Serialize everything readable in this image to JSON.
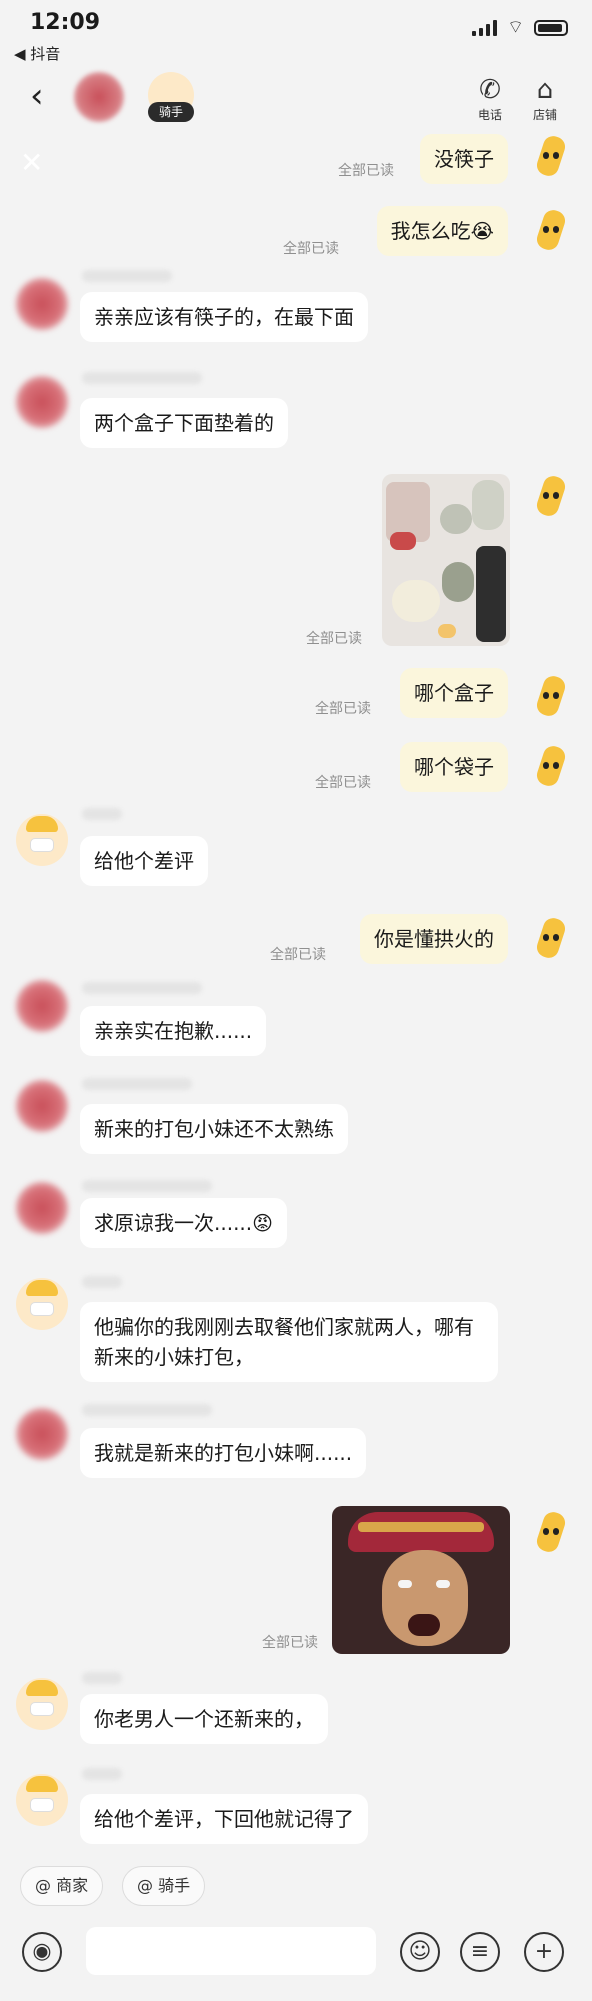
{
  "status": {
    "time": "12:09",
    "back_app": "◀ 抖音"
  },
  "header": {
    "rider_tag": "骑手",
    "phone_label": "电话",
    "store_label": "店铺"
  },
  "chat": {
    "read_label": "全部已读",
    "m1": "没筷子",
    "m2": "我怎么吃😭",
    "m3": "亲亲应该有筷子的，在最下面",
    "m4": "两个盒子下面垫着的",
    "m6": "哪个盒子",
    "m7": "哪个袋子",
    "m8": "给他个差评",
    "m9": "你是懂拱火的",
    "m10": "亲亲实在抱歉......",
    "m11": "新来的打包小妹还不太熟练",
    "m12": "求原谅我一次......😡",
    "m13": "他骗你的我刚刚去取餐他们家就两人，哪有新来的小妹打包，",
    "m14": "我就是新来的打包小妹啊......",
    "m16": "你老男人一个还新来的，",
    "m17": "给他个差评，下回他就记得了"
  },
  "quick": {
    "merchant": "@ 商家",
    "rider": "@ 骑手"
  },
  "icons": {
    "back": "chevron-left-icon",
    "phone": "phone-icon",
    "store": "store-icon",
    "close": "close-icon",
    "voice": "voice-icon",
    "emoji": "emoji-icon",
    "more": "list-icon",
    "add": "plus-icon"
  },
  "colors": {
    "background": "#f3f3f3",
    "incoming_bubble": "#ffffff",
    "outgoing_bubble": "#fbf6dc",
    "read_text": "#8f8f8f"
  }
}
